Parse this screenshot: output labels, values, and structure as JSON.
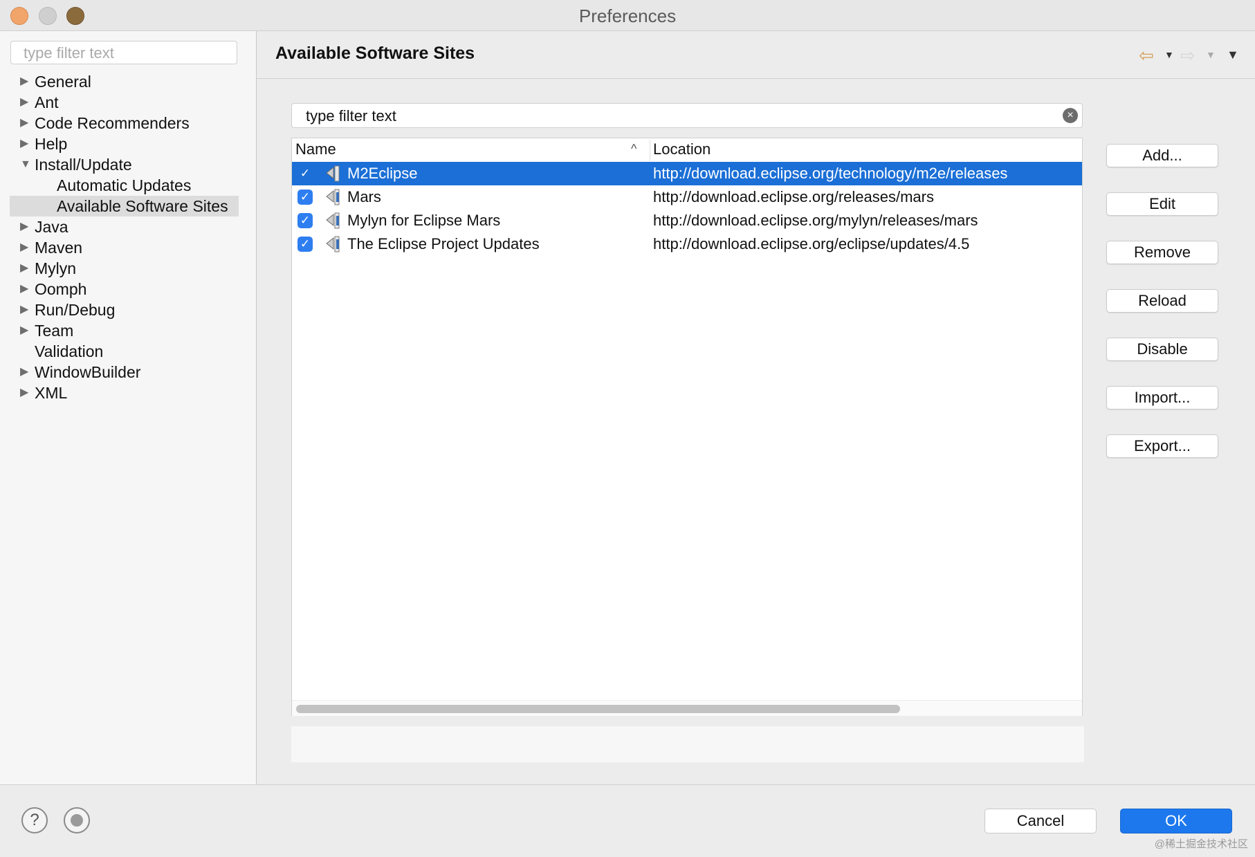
{
  "window": {
    "title": "Preferences"
  },
  "sidebar": {
    "filter_placeholder": "type filter text",
    "items": [
      {
        "label": "General",
        "arrow": "▶"
      },
      {
        "label": "Ant",
        "arrow": "▶"
      },
      {
        "label": "Code Recommenders",
        "arrow": "▶"
      },
      {
        "label": "Help",
        "arrow": "▶"
      },
      {
        "label": "Install/Update",
        "arrow": "▼"
      },
      {
        "label": "Automatic Updates"
      },
      {
        "label": "Available Software Sites"
      },
      {
        "label": "Java",
        "arrow": "▶"
      },
      {
        "label": "Maven",
        "arrow": "▶"
      },
      {
        "label": "Mylyn",
        "arrow": "▶"
      },
      {
        "label": "Oomph",
        "arrow": "▶"
      },
      {
        "label": "Run/Debug",
        "arrow": "▶"
      },
      {
        "label": "Team",
        "arrow": "▶"
      },
      {
        "label": "Validation"
      },
      {
        "label": "WindowBuilder",
        "arrow": "▶"
      },
      {
        "label": "XML",
        "arrow": "▶"
      }
    ]
  },
  "page": {
    "title": "Available Software Sites",
    "nav_icons": [
      "back-arrow-icon",
      "forward-arrow-icon",
      "view-menu-icon"
    ]
  },
  "filter": {
    "value": "type filter text",
    "clear_icon": "clear-icon"
  },
  "table": {
    "columns": [
      "Name",
      "Location"
    ],
    "sort_indicator": "^",
    "rows": [
      {
        "checked": true,
        "name": "M2Eclipse",
        "location": "http://download.eclipse.org/technology/m2e/releases",
        "selected": true
      },
      {
        "checked": true,
        "name": "Mars",
        "location": "http://download.eclipse.org/releases/mars"
      },
      {
        "checked": true,
        "name": "Mylyn for Eclipse Mars",
        "location": "http://download.eclipse.org/mylyn/releases/mars"
      },
      {
        "checked": true,
        "name": "The Eclipse Project Updates",
        "location": "http://download.eclipse.org/eclipse/updates/4.5"
      }
    ]
  },
  "buttons": {
    "add": "Add...",
    "edit": "Edit",
    "remove": "Remove",
    "reload": "Reload",
    "disable": "Disable",
    "import": "Import...",
    "export": "Export..."
  },
  "footer": {
    "help": "?",
    "cancel": "Cancel",
    "ok": "OK",
    "watermark": "@稀土掘金技术社区"
  },
  "colors": {
    "selection": "#1b6fd6",
    "ok_button": "#1d78ee",
    "checkbox": "#2e7ef0"
  }
}
